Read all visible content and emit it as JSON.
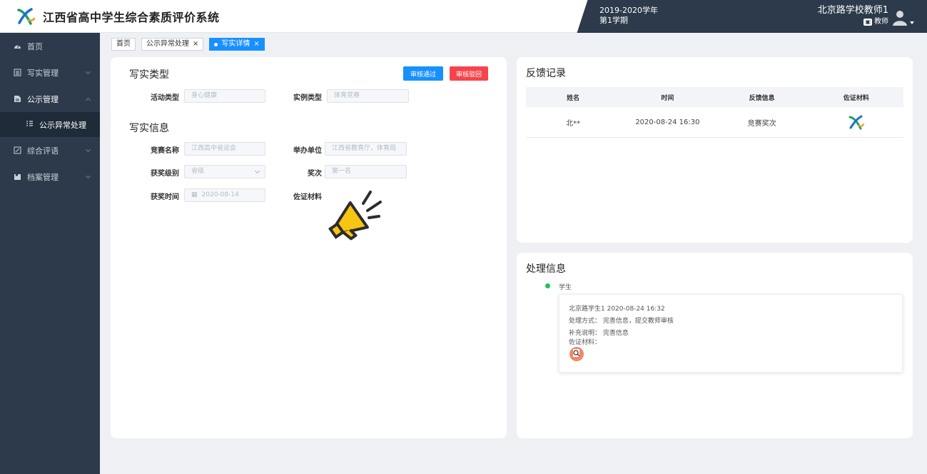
{
  "header": {
    "app_title": "江西省高中学生综合素质评价系统",
    "term_year": "2019-2020学年",
    "term_semester": "第1学期",
    "user_name": "北京路学校教师1",
    "user_role": "教师"
  },
  "sidebar": {
    "items": [
      {
        "label": "首页",
        "icon": "dashboard-icon"
      },
      {
        "label": "写实管理",
        "icon": "list-icon"
      },
      {
        "label": "公示管理",
        "icon": "document-icon"
      },
      {
        "label": "综合评语",
        "icon": "edit-icon"
      },
      {
        "label": "档案管理",
        "icon": "folder-icon"
      }
    ],
    "sub_item": "公示异常处理"
  },
  "tabs": {
    "home": "首页",
    "exception": "公示异常处理",
    "detail": "写实详情"
  },
  "record_type": {
    "title": "写实类型",
    "approve_label": "审核通过",
    "reject_label": "审核驳回",
    "activity_type_label": "活动类型",
    "activity_type_value": "身心健康",
    "case_type_label": "实例类型",
    "case_type_value": "体育竞赛"
  },
  "record_info": {
    "title": "写实信息",
    "contest_name_label": "竞赛名称",
    "contest_name_value": "江西高中省运会",
    "organizer_label": "举办单位",
    "organizer_value": "江西省教育厅，体育局",
    "award_level_label": "获奖级别",
    "award_level_value": "省级",
    "award_label": "奖次",
    "award_value": "第一名",
    "award_date_label": "获奖时间",
    "award_date_value": "2020-08-14",
    "evidence_label": "佐证材料"
  },
  "feedback": {
    "title": "反馈记录",
    "columns": [
      "姓名",
      "时间",
      "反馈信息",
      "佐证材料"
    ],
    "rows": [
      {
        "name": "北**",
        "time": "2020-08-24 16:30",
        "info": "竞赛奖次"
      }
    ]
  },
  "process": {
    "title": "处理信息",
    "timeline_label": "学生",
    "entry_header": "北京路学生1  2020-08-24 16:32",
    "method": "处理方式：  完善信息，提交教师审核",
    "note": "补充说明：  完善信息",
    "evidence": "佐证材料："
  },
  "colors": {
    "sidebar_bg": "#2c3a4b",
    "primary": "#1890ff",
    "danger": "#f5454c",
    "success": "#21c15c"
  }
}
